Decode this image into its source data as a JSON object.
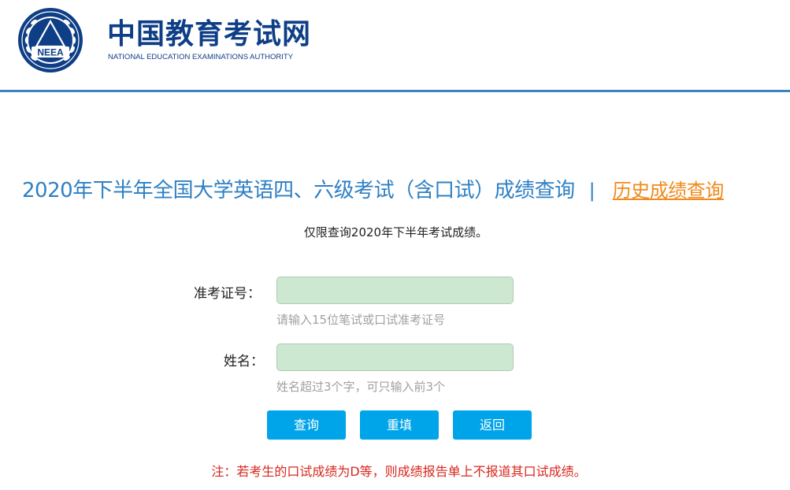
{
  "header": {
    "site_name": "中国教育考试网",
    "site_name_en": "NATIONAL EDUCATION EXAMINATIONS AUTHORITY",
    "emblem_text": "NEEA"
  },
  "title": {
    "main": "2020年下半年全国大学英语四、六级考试（含口试）成绩查询",
    "separator": "|",
    "history_link": "历史成绩查询"
  },
  "notice": "仅限查询2020年下半年考试成绩。",
  "form": {
    "ticket": {
      "label": "准考证号：",
      "value": "",
      "hint": "请输入15位笔试或口试准考证号"
    },
    "name": {
      "label": "姓名：",
      "value": "",
      "hint": "姓名超过3个字，可只输入前3个"
    }
  },
  "buttons": {
    "query": "查询",
    "reset": "重填",
    "back": "返回"
  },
  "footnote": "注：若考生的口试成绩为D等，则成绩报告单上不报道其口试成绩。",
  "colors": {
    "brand_blue": "#0e3e86",
    "title_blue": "#2f80c4",
    "link_orange": "#f08a1c",
    "button_blue": "#00a4e8",
    "input_green": "#cce8d0",
    "warning_red": "#d9261c"
  }
}
